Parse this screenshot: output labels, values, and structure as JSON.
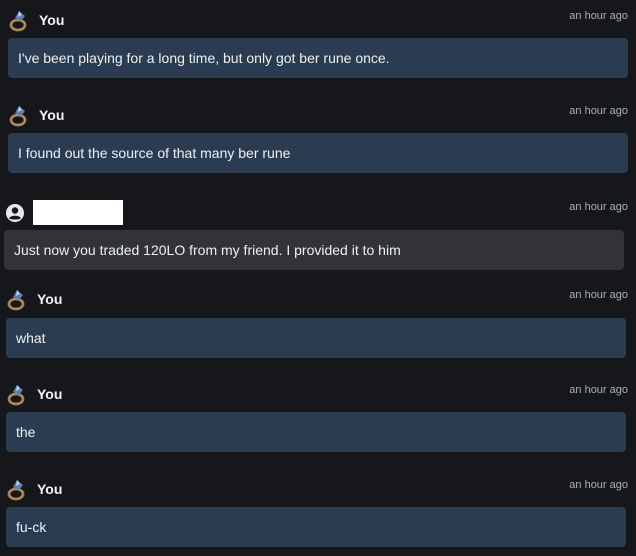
{
  "icons": {
    "self_avatar": "gem-ring-icon",
    "other_avatar": "user-circle-icon"
  },
  "colors": {
    "self_bubble": "#2b3c50",
    "other_bubble": "#323336",
    "background": "#16171a"
  },
  "messages": [
    {
      "sender": "You",
      "time": "an hour ago",
      "text": "I've been playing for a long time, but only got ber rune once."
    },
    {
      "sender": "You",
      "time": "an hour ago",
      "text": "I found out the source of that many ber rune"
    },
    {
      "sender": "",
      "time": "an hour ago",
      "text": "Just now you traded 120LO from my friend. I provided it to him"
    },
    {
      "sender": "You",
      "time": "an hour ago",
      "text": "what"
    },
    {
      "sender": "You",
      "time": "an hour ago",
      "text": "the"
    },
    {
      "sender": "You",
      "time": "an hour ago",
      "text": "fu-ck"
    }
  ]
}
